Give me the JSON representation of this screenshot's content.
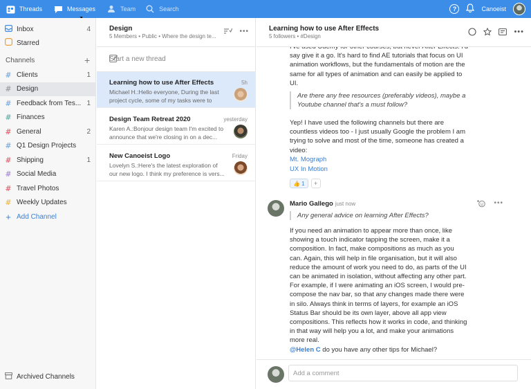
{
  "topbar": {
    "threads": "Threads",
    "messages": "Messages",
    "team": "Team",
    "search": "Search",
    "user": "Canoeist",
    "help": "?",
    "accent": "#3b8de8"
  },
  "sidebar": {
    "inbox": {
      "label": "Inbox",
      "count": "4"
    },
    "starred": {
      "label": "Starred"
    },
    "channels_header": "Channels",
    "channels": [
      {
        "label": "Clients",
        "count": "1",
        "color": "#6a9fd8"
      },
      {
        "label": "Design",
        "count": "",
        "color": "#8e8e8e"
      },
      {
        "label": "Feedback from Tes...",
        "count": "1",
        "color": "#6a9fd8"
      },
      {
        "label": "Finances",
        "count": "",
        "color": "#4aa39a"
      },
      {
        "label": "General",
        "count": "2",
        "color": "#d94f5c"
      },
      {
        "label": "Q1 Design Projects",
        "count": "",
        "color": "#6a9fd8"
      },
      {
        "label": "Shipping",
        "count": "1",
        "color": "#d94f5c"
      },
      {
        "label": "Social Media",
        "count": "",
        "color": "#9a7bd0"
      },
      {
        "label": "Travel Photos",
        "count": "",
        "color": "#d94f5c"
      },
      {
        "label": "Weekly Updates",
        "count": "",
        "color": "#e8b23b"
      }
    ],
    "add_channel": "Add Channel",
    "archived": "Archived Channels"
  },
  "thread_list": {
    "title": "Design",
    "subtitle": "5 Members • Public • Where the design te...",
    "new_thread": "Start a new thread",
    "items": [
      {
        "title": "Learning how to use After Effects",
        "time": "5h",
        "preview": "Michael H.:Hello everyone, During the last project cycle, some of my tasks were to"
      },
      {
        "title": "Design Team Retreat 2020",
        "time": "yesterday",
        "preview": "Karen A.:Bonjour design team    I'm excited to announce that we're closing in on a dec..."
      },
      {
        "title": "New Canoeist Logo",
        "time": "Friday",
        "preview": "Lovelyn S.:Here's the latest exploration of our new logo. I think my preference is vers..."
      }
    ]
  },
  "main": {
    "title": "Learning how to use After Effects",
    "subtitle": "5 followers • #Design",
    "msg1_text": "I've used Udemy for other courses, but never After Effects. I'd say give it a go. It's hard to find AE tutorials that focus on UI animation workflows, but the fundamentals of motion are the same for all types of animation and can easily be applied to UI.",
    "msg1_quote": "Are there any free resources (preferably videos), maybe a Youtube channel that's a must follow?",
    "msg1_text2": "Yep! I have used the following channels but there are countless videos too - I just usually Google the problem I am trying to solve and most of the time, someone has created a video:",
    "link1": "Mt. Mograph",
    "link2": "UX In Motion",
    "reaction": "👍 1",
    "reaction_add": "+",
    "msg2_author": "Mario Gallego",
    "msg2_time": "just now",
    "msg2_quote": "Any general advice on learning After Effects?",
    "msg2_text": "If you need an animation to appear more than once, like showing a touch indicator tapping the screen, make it a composition. In fact, make compositions as much as you can. Again, this will help in file organisation, but it will also reduce the amount of work you need to do, as parts of the UI can be animated in isolation, without affecting any other part. For example, if I were animating an iOS screen, I would pre-compose the nav bar, so that any changes made there were in silo. Always think in terms of layers, for example an iOS Status Bar should be its own layer, above all app view compositions. This reflects how it works in code, and thinking in that way will help you a lot, and make your animations more real.",
    "mention": "@Helen C",
    "mention_text": " do you have any other tips for Michael?",
    "comment_placeholder": "Add a comment"
  }
}
